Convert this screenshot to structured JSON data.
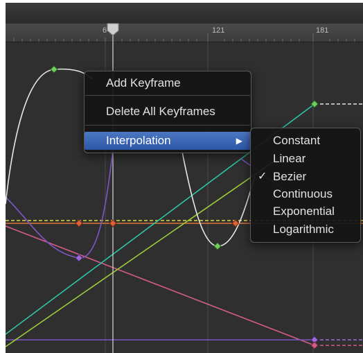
{
  "ruler": {
    "ticks": [
      {
        "label": "6"
      },
      {
        "label": "121"
      },
      {
        "label": "181"
      }
    ]
  },
  "context_menu": {
    "items": [
      {
        "label": "Add Keyframe"
      },
      {
        "label": "Delete All Keyframes"
      },
      {
        "label": "Interpolation",
        "has_submenu": true,
        "highlighted": true
      }
    ],
    "submenu_arrow": "▶"
  },
  "interpolation_submenu": {
    "items": [
      {
        "label": "Constant",
        "checked": false
      },
      {
        "label": "Linear",
        "checked": false
      },
      {
        "label": "Bezier",
        "checked": true
      },
      {
        "label": "Continuous",
        "checked": false
      },
      {
        "label": "Exponential",
        "checked": false
      },
      {
        "label": "Logarithmic",
        "checked": false
      }
    ],
    "check_mark": "✓"
  },
  "colors": {
    "white_curve": "#e8e8e8",
    "purple_curve": "#7d57c6",
    "teal_curve": "#2ec4a6",
    "yellow_green_curve": "#9ccc3a",
    "orange_curve": "#e07b3a",
    "yellow_dashed": "#e8d84a",
    "pink_curve": "#d45c8a",
    "keyframe_green": "#6fcf5a",
    "keyframe_red": "#e0603a",
    "keyframe_purple": "#a06ad8",
    "menu_highlight": "#3b66b8"
  }
}
